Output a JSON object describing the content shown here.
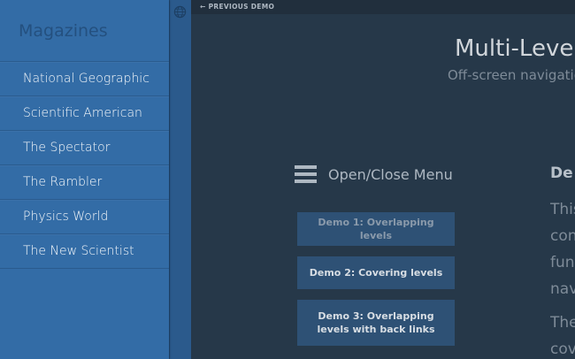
{
  "menu": {
    "title": "Magazines",
    "items": [
      {
        "label": "National Geographic"
      },
      {
        "label": "Scientific American"
      },
      {
        "label": "The Spectator"
      },
      {
        "label": "The Rambler"
      },
      {
        "label": "Physics World"
      },
      {
        "label": "The New Scientist"
      }
    ]
  },
  "topbar": {
    "prev_demo": "PREVIOUS DEMO"
  },
  "header": {
    "title": "Multi-Level",
    "subtitle": "Off-screen navigation"
  },
  "trigger": {
    "label": "Open/Close Menu"
  },
  "demos": [
    {
      "label": "Demo 1: Overlapping levels"
    },
    {
      "label": "Demo 2: Covering levels"
    },
    {
      "label": "Demo 3: Overlapping levels with back links"
    }
  ],
  "sidebar_text": {
    "heading": "De",
    "para1": [
      "This",
      "con",
      "func",
      "nav"
    ],
    "para2": [
      "The",
      "cov"
    ]
  },
  "colors": {
    "menu_bg": "#336ca6",
    "content_bg": "#263849",
    "button_bg": "#2e5175"
  }
}
